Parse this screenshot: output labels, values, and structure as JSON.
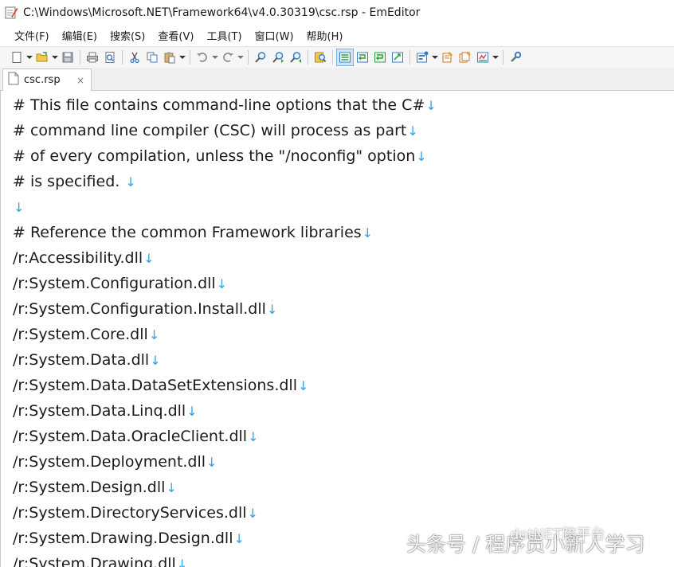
{
  "window": {
    "title": "C:\\Windows\\Microsoft.NET\\Framework64\\v4.0.30319\\csc.rsp - EmEditor",
    "icon": "emeditor-app-icon"
  },
  "menu": {
    "items": [
      {
        "label": "文件(F)"
      },
      {
        "label": "编辑(E)"
      },
      {
        "label": "搜索(S)"
      },
      {
        "label": "查看(V)"
      },
      {
        "label": "工具(T)"
      },
      {
        "label": "窗口(W)"
      },
      {
        "label": "帮助(H)"
      }
    ]
  },
  "toolbar": {
    "buttons": [
      "new-file-icon",
      "open-folder-icon",
      "save-icon",
      "print-icon",
      "print-preview-icon",
      "cut-icon",
      "copy-icon",
      "paste-icon",
      "undo-icon",
      "redo-icon",
      "find-icon",
      "find-next-icon",
      "find-previous-icon",
      "find-in-files-icon",
      "wrap-none-icon",
      "wrap-by-chars-icon",
      "wrap-by-window-icon",
      "wrap-by-page-icon",
      "markers-icon",
      "properties-icon",
      "all-properties-icon",
      "macros-icon",
      "customize-icon"
    ]
  },
  "tabs": [
    {
      "label": "csc.rsp",
      "close": "×"
    }
  ],
  "editor": {
    "newline_marker": "↓",
    "lines": [
      "# This file contains command-line options that the C#",
      "# command line compiler (CSC) will process as part",
      "# of every compilation, unless the \"/noconfig\" option",
      "# is specified. ",
      "",
      "# Reference the common Framework libraries",
      "/r:Accessibility.dll",
      "/r:System.Configuration.dll",
      "/r:System.Configuration.Install.dll",
      "/r:System.Core.dll",
      "/r:System.Data.dll",
      "/r:System.Data.DataSetExtensions.dll",
      "/r:System.Data.Linq.dll",
      "/r:System.Data.OracleClient.dll",
      "/r:System.Deployment.dll",
      "/r:System.Design.dll",
      "/r:System.DirectoryServices.dll",
      "/r:System.Drawing.Design.dll",
      "/r:System.Drawing.dll"
    ]
  },
  "watermark": {
    "main": "头条号 / 程序员小新人学习",
    "sub": "dotNET跨平台"
  },
  "colors": {
    "newline_marker": "#2aa6e8",
    "toolbar_bg": "#f6f6f6",
    "tab_strip_bg": "#f0f0f0"
  }
}
